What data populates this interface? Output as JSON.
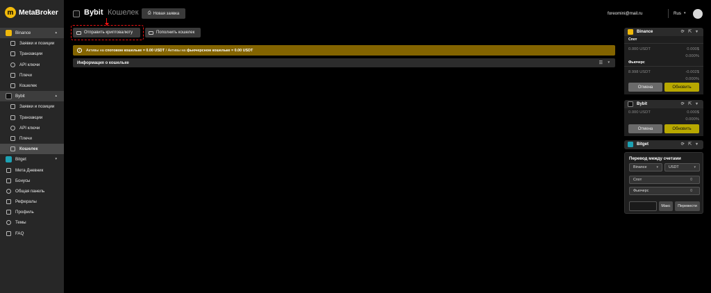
{
  "brand": {
    "name": "MetaBroker",
    "mark": "m"
  },
  "sidebar": {
    "items": [
      {
        "label": "Binance",
        "type": "exchange",
        "exchange": "binance"
      },
      {
        "label": "Заявки и позиции",
        "type": "sub"
      },
      {
        "label": "Транзакции",
        "type": "sub"
      },
      {
        "label": "API ключи",
        "type": "sub"
      },
      {
        "label": "Плечи",
        "type": "sub"
      },
      {
        "label": "Кошелек",
        "type": "sub"
      },
      {
        "label": "Bybit",
        "type": "exchange",
        "exchange": "bybit"
      },
      {
        "label": "Заявки и позиции",
        "type": "sub"
      },
      {
        "label": "Транзакции",
        "type": "sub"
      },
      {
        "label": "API ключи",
        "type": "sub"
      },
      {
        "label": "Плечи",
        "type": "sub"
      },
      {
        "label": "Кошелек",
        "type": "sub",
        "active": true
      },
      {
        "label": "Bitget",
        "type": "exchange",
        "exchange": "bitget"
      },
      {
        "label": "Мета Дневник",
        "type": "top"
      },
      {
        "label": "Бонусы",
        "type": "top"
      },
      {
        "label": "Общая панель",
        "type": "top"
      },
      {
        "label": "Рефералы",
        "type": "top"
      },
      {
        "label": "Профиль",
        "type": "top"
      },
      {
        "label": "Темы",
        "type": "top"
      },
      {
        "label": "FAQ",
        "type": "top"
      }
    ]
  },
  "header": {
    "title": "Bybit",
    "subtitle": "Кошелек",
    "new_order_label": "Новая заявка",
    "email": "foreomini@mail.ru",
    "lang": "Rus"
  },
  "actions": {
    "send_crypto_label": "Отправить криптовалюту",
    "fill_wallet_label": "Пополнить кошелек"
  },
  "banner": {
    "prefix": "Активы на ",
    "spot_bold": "спотовом кошельке = 0.00 USDT",
    "mid": " / Активы на ",
    "fut_bold": "фьючерсном кошельке = 0.00 USDT"
  },
  "wallet_info": {
    "label": "Информация о кошельке"
  },
  "panel": {
    "binance": {
      "name": "Binance",
      "spot_label": "Спот",
      "spot_value": "0.000 USDT",
      "spot_pnl": "0.000$",
      "spot_pct": "0.000%",
      "fut_label": "Фьючерс",
      "fut_value": "8.998 USDT",
      "fut_pnl": "-0.002$",
      "fut_pct": "0.000%",
      "cancel_label": "Отмена",
      "update_label": "Обновить"
    },
    "bybit": {
      "name": "Bybit",
      "value": "0.000 USDT",
      "pnl": "0.000$",
      "pct": "0.000%",
      "cancel_label": "Отмена",
      "update_label": "Обновить"
    },
    "bitget": {
      "name": "Bitget"
    },
    "transfer": {
      "title": "Перевод между счетами",
      "exchange_value": "Binance",
      "coin_value": "USDT",
      "from_label": "Спот",
      "from_value": "0",
      "to_label": "Фьючерс",
      "to_value": "0",
      "max_label": "Макс",
      "transfer_label": "Перевести"
    },
    "tools_glyphs": "⟳ ⇱ ▾"
  },
  "colors": {
    "accent": "#b8a800",
    "banner": "#836400",
    "highlight": "#ee1111",
    "binance": "#f0b90b",
    "bitget": "#1da2b4"
  }
}
